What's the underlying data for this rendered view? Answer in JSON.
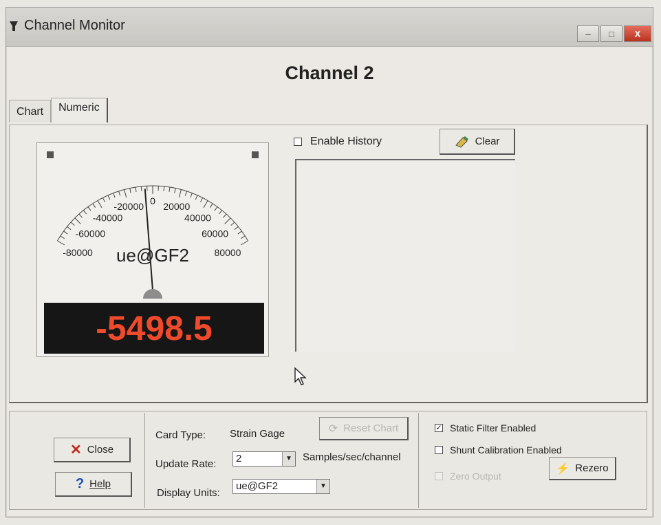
{
  "window": {
    "title": "Channel Monitor",
    "minimize": "–",
    "maximize": "□",
    "close": "X"
  },
  "heading": "Channel 2",
  "tabs": [
    {
      "label": "Chart"
    },
    {
      "label": "Numeric"
    }
  ],
  "meter": {
    "scale_labels": [
      "-80000",
      "-60000",
      "-40000",
      "-20000",
      "0",
      "20000",
      "40000",
      "60000",
      "80000"
    ],
    "unit": "ue@GF2",
    "value": "-5498.5",
    "readout_color": "#f04a2c"
  },
  "history": {
    "enable_label": "Enable History",
    "enabled": false,
    "clear_label": "Clear"
  },
  "bottom": {
    "close_label": "Close",
    "help_label": "Help",
    "card_type_label": "Card Type:",
    "card_type_value": "Strain Gage",
    "reset_chart_label": "Reset Chart",
    "update_rate_label": "Update Rate:",
    "update_rate_value": "2",
    "update_rate_unit": "Samples/sec/channel",
    "display_units_label": "Display Units:",
    "display_units_value": "ue@GF2",
    "static_filter_label": "Static Filter Enabled",
    "static_filter_checked": true,
    "shunt_cal_label": "Shunt Calibration Enabled",
    "zero_output_label": "Zero Output",
    "rezero_label": "Rezero"
  }
}
